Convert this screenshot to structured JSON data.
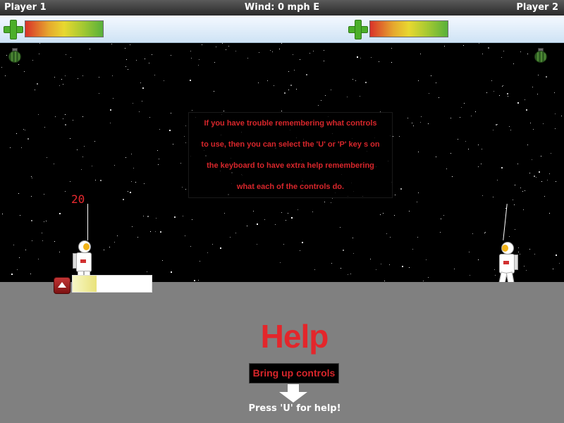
{
  "topbar": {
    "player1": "Player 1",
    "wind": "Wind: 0 mph E",
    "player2": "Player 2"
  },
  "health": {
    "player1_icon": "plus-icon",
    "player2_icon": "plus-icon"
  },
  "weapons": {
    "player1_icon": "grenade-icon",
    "player2_icon": "grenade-icon"
  },
  "message": {
    "lines": [
      "If you have trouble remembering what controls",
      "to use, then you can select the 'U' or 'P' key s on",
      "the keyboard to have extra help remembering",
      "what each of the controls do."
    ]
  },
  "player1": {
    "power_value": "20",
    "power_fraction": 0.3
  },
  "help": {
    "title": "Help",
    "button_label": "Bring up controls",
    "hint": "Press 'U' for help!"
  },
  "colors": {
    "accent_red": "#e3262b",
    "ground": "#808080",
    "space": "#000000"
  }
}
